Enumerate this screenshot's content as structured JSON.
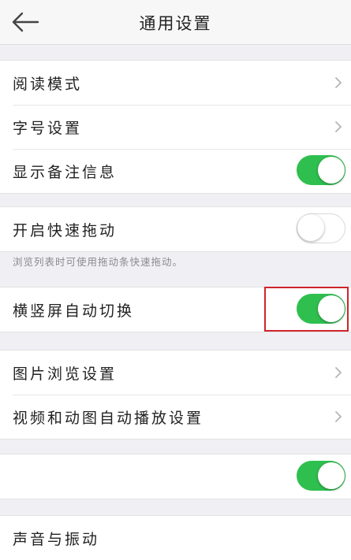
{
  "header": {
    "title": "通用设置",
    "back_icon": "arrow-left-icon"
  },
  "groups": [
    {
      "rows": [
        {
          "label": "阅读模式",
          "control": "chevron"
        },
        {
          "label": "字号设置",
          "control": "chevron"
        },
        {
          "label": "显示备注信息",
          "control": "toggle",
          "state": "on"
        }
      ]
    },
    {
      "rows": [
        {
          "label": "开启快速拖动",
          "control": "toggle",
          "state": "off"
        }
      ],
      "hint": "浏览列表时可使用拖动条快速拖动。"
    },
    {
      "rows": [
        {
          "label": "横竖屏自动切换",
          "control": "toggle",
          "state": "on",
          "highlighted": true
        }
      ]
    },
    {
      "rows": [
        {
          "label": "图片浏览设置",
          "control": "chevron"
        },
        {
          "label": "视频和动图自动播放设置",
          "control": "chevron"
        }
      ]
    },
    {
      "rows": [
        {
          "label": "",
          "control": "toggle",
          "state": "on"
        }
      ]
    },
    {
      "rows": [
        {
          "label": "声音与振动",
          "control": "none"
        }
      ]
    }
  ],
  "colors": {
    "toggle_on": "#2fbf4f",
    "highlight_border": "#d0242b",
    "background": "#f0eff4"
  }
}
